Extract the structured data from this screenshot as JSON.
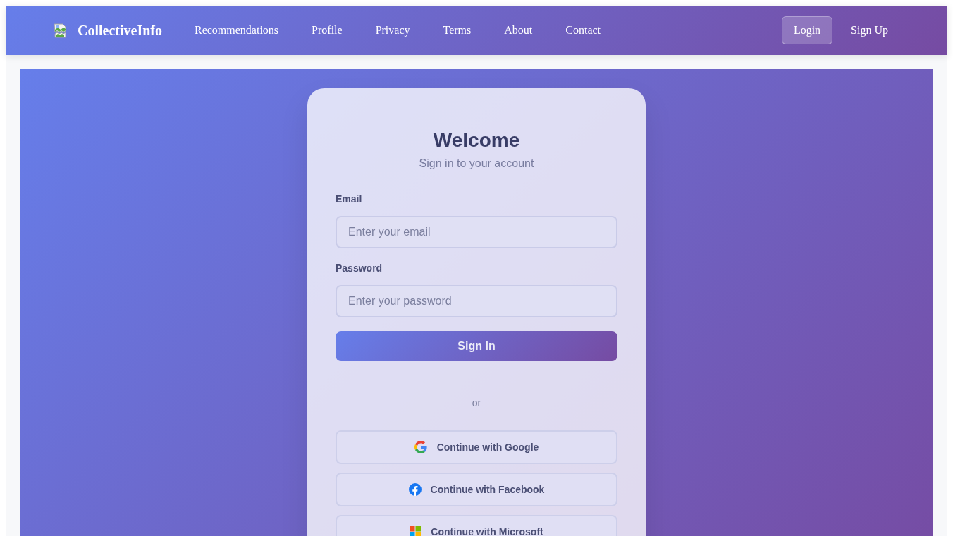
{
  "header": {
    "brand": "CollectiveInfo",
    "nav": [
      {
        "label": "Recommendations"
      },
      {
        "label": "Profile"
      },
      {
        "label": "Privacy"
      },
      {
        "label": "Terms"
      },
      {
        "label": "About"
      },
      {
        "label": "Contact"
      }
    ],
    "auth": [
      {
        "label": "Login",
        "kind": "button"
      },
      {
        "label": "Sign Up",
        "kind": "link"
      }
    ]
  },
  "login_card": {
    "title": "Welcome",
    "subtitle": "Sign in to your account",
    "fields": [
      {
        "label": "Email",
        "placeholder": "Enter your email"
      },
      {
        "label": "Password",
        "placeholder": "Enter your password"
      }
    ],
    "submit": "Sign In",
    "divider": "or",
    "social": [
      {
        "label": "Continue with Google",
        "kind": "google"
      },
      {
        "label": "Continue with Facebook",
        "kind": "facebook"
      },
      {
        "label": "Continue with Microsoft",
        "kind": "microsoft"
      }
    ]
  }
}
